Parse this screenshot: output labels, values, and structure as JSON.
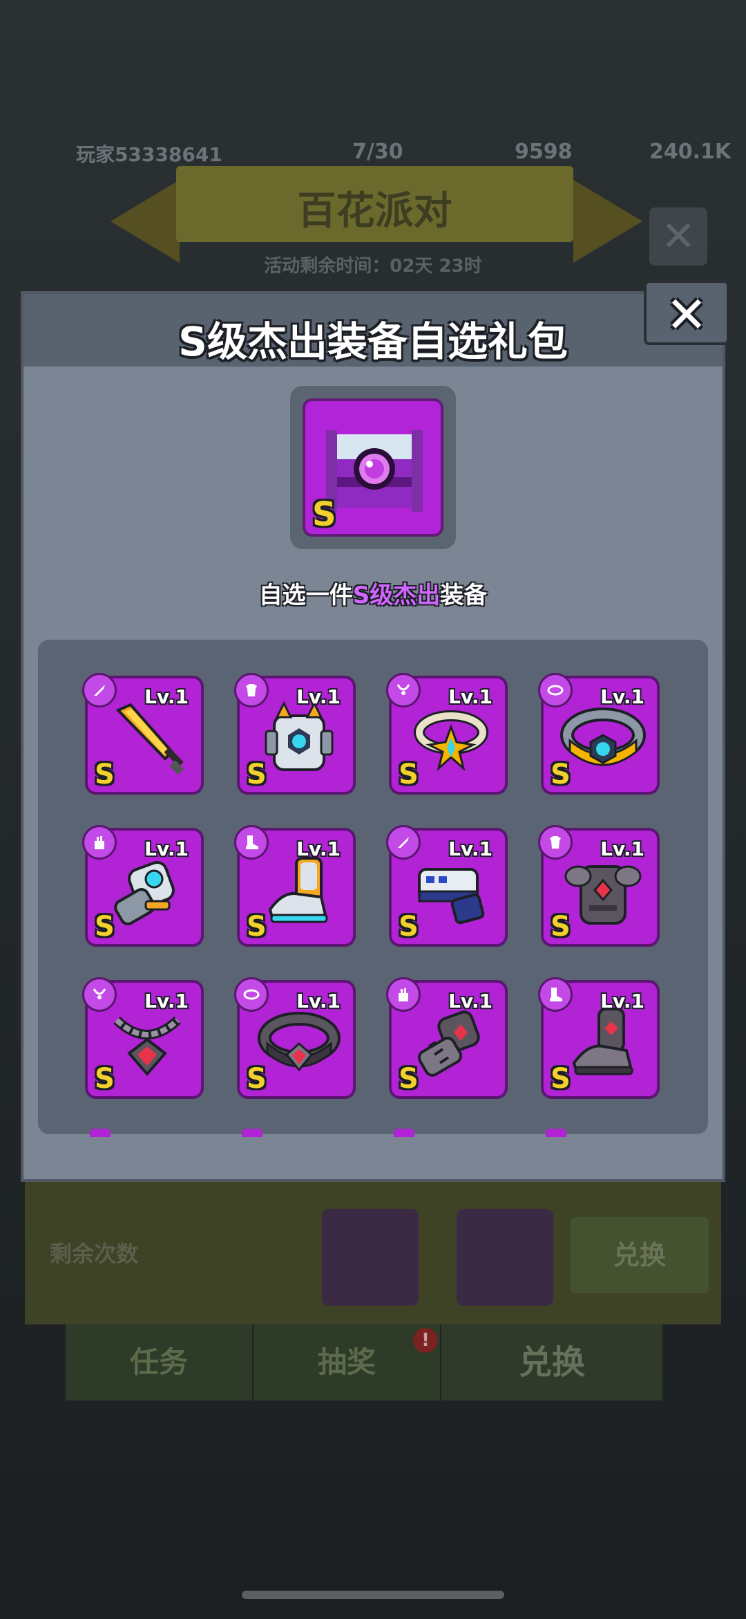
{
  "background": {
    "player_name": "玩家53338641",
    "stats": [
      "7/30",
      "9598",
      "240.1K"
    ],
    "event_title": "百花派对",
    "timer_text": "活动剩余时间：02天 23时",
    "remaining_label": "剩余次数",
    "exchange_small": "兑换",
    "tabs": [
      "任务",
      "抽奖",
      "兑换"
    ],
    "badge": "!"
  },
  "modal": {
    "title": "S级杰出装备自选礼包",
    "chest_grade": "S",
    "description_prefix": "自选一件",
    "description_highlight": "S级杰出",
    "description_suffix": "装备",
    "close_symbol": "✕"
  },
  "items": [
    {
      "name": "sword",
      "type_icon": "weapon-icon",
      "level": "Lv.1",
      "grade": "S"
    },
    {
      "name": "armor",
      "type_icon": "armor-icon",
      "level": "Lv.1",
      "grade": "S"
    },
    {
      "name": "ring",
      "type_icon": "necklace-icon",
      "level": "Lv.1",
      "grade": "S"
    },
    {
      "name": "belt",
      "type_icon": "belt-icon",
      "level": "Lv.1",
      "grade": "S"
    },
    {
      "name": "gauntlet",
      "type_icon": "glove-icon",
      "level": "Lv.1",
      "grade": "S"
    },
    {
      "name": "boot",
      "type_icon": "boot-icon",
      "level": "Lv.1",
      "grade": "S"
    },
    {
      "name": "blaster",
      "type_icon": "weapon-icon",
      "level": "Lv.1",
      "grade": "S"
    },
    {
      "name": "dark-armor",
      "type_icon": "armor-icon",
      "level": "Lv.1",
      "grade": "S"
    },
    {
      "name": "dark-necklace",
      "type_icon": "necklace-icon",
      "level": "Lv.1",
      "grade": "S"
    },
    {
      "name": "dark-belt",
      "type_icon": "belt-icon",
      "level": "Lv.1",
      "grade": "S"
    },
    {
      "name": "dark-gauntlet",
      "type_icon": "glove-icon",
      "level": "Lv.1",
      "grade": "S"
    },
    {
      "name": "dark-boot",
      "type_icon": "boot-icon",
      "level": "Lv.1",
      "grade": "S"
    }
  ],
  "colors": {
    "card_purple": "#b223d6",
    "grade_yellow": "#f2d12c",
    "highlight_purple": "#d266ff",
    "modal_gray": "#7b8594"
  }
}
